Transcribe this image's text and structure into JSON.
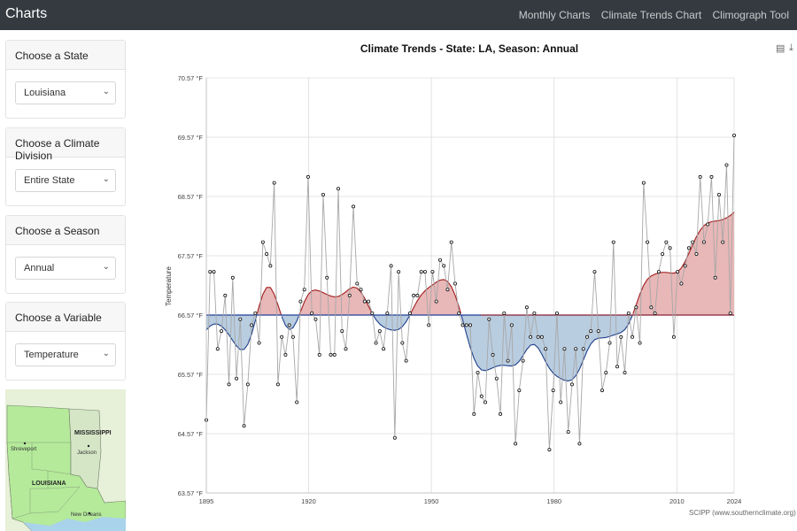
{
  "navbar": {
    "brand": "Charts",
    "links": [
      "Monthly Charts",
      "Climate Trends Chart",
      "Climograph Tool"
    ]
  },
  "sidebar": {
    "panels": [
      {
        "label": "Choose a State",
        "value": "Louisiana"
      },
      {
        "label": "Choose a Climate Division",
        "value": "Entire State"
      },
      {
        "label": "Choose a Season",
        "value": "Annual"
      },
      {
        "label": "Choose a Variable",
        "value": "Temperature"
      }
    ],
    "map": {
      "labels": [
        "MISSISSIPPI",
        "Shreveport",
        "Jackson",
        "LOUISIANA",
        "New Orleans"
      ]
    }
  },
  "chart": {
    "title": "Climate Trends - State: LA, Season: Annual",
    "credit": "SCIPP (www.southernclimate.org)",
    "colors": {
      "above": "#e8b7b7",
      "above_line": "#a11b1b",
      "below": "#b9cde0",
      "below_line": "#1d3f8a",
      "raw_line": "#a7a7a7",
      "mean_line": "#1f3c99"
    }
  },
  "chart_data": {
    "type": "line",
    "title": "Climate Trends - State: LA, Season: Annual",
    "xlabel": "",
    "ylabel": "Temperature",
    "xlim": [
      1895,
      2024
    ],
    "ylim": [
      63.57,
      70.57
    ],
    "x_ticks": [
      1895,
      1920,
      1950,
      1980,
      2010,
      2024
    ],
    "y_ticks": [
      "63.57 °F",
      "64.57 °F",
      "65.57 °F",
      "66.57 °F",
      "67.57 °F",
      "68.57 °F",
      "69.57 °F",
      "70.57 °F"
    ],
    "baseline": 66.57,
    "grid": true,
    "series": [
      {
        "values": [
          64.8,
          67.3,
          67.3,
          66,
          66.3,
          66.9,
          65.4,
          67.2,
          65.5,
          66.5,
          64.7,
          65.4,
          66.4,
          66.6,
          66.1,
          67.8,
          67.6,
          67.4,
          68.8,
          65.4,
          66.2,
          65.9,
          66.4,
          66.2,
          65.1,
          66.8,
          67,
          68.9,
          66.6,
          66.5,
          65.9,
          68.6,
          67.2,
          65.9,
          65.9,
          68.7,
          66.3,
          66,
          66.9,
          68.4,
          67.1,
          67,
          66.8,
          66.8,
          66.6,
          66.1,
          66.3,
          66,
          66.6,
          67.4,
          64.5,
          67.3,
          66.1,
          65.8,
          66.6,
          66.9,
          66.9,
          67.3,
          67.3,
          66.4,
          67.3,
          66.8,
          67.5,
          67.4,
          67,
          67.8,
          67.1,
          66.6,
          66.4,
          66.4,
          66.4,
          64.9,
          65.6,
          65.2,
          65.1,
          66.5,
          65.9,
          65.5,
          64.9,
          66.6,
          65.8,
          66.4,
          64.4,
          65.3,
          65.8,
          66.7,
          66.2,
          66.6,
          66.2,
          66.2,
          66,
          64.3,
          65.3,
          66.6,
          65.1,
          66,
          64.6,
          65.4,
          66,
          64.4,
          66,
          66.2,
          66.3,
          67.3,
          66.3,
          65.3,
          65.6,
          66.1,
          67.8,
          65.7,
          66.2,
          65.6,
          66.6,
          66.2,
          66.7,
          66.1,
          68.8,
          67.8,
          66.7,
          66.6,
          67.3,
          67.6,
          67.8,
          67.7,
          66.2,
          67.3,
          67.1,
          67.4,
          67.7,
          67.8,
          67.6,
          68.9,
          67.8,
          68.1,
          68.9,
          67.2,
          68.6,
          67.8,
          69.1,
          66.6,
          69.6
        ]
      }
    ]
  }
}
